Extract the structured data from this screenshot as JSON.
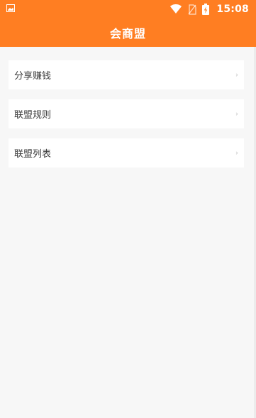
{
  "status_bar": {
    "time": "15:08"
  },
  "header": {
    "title": "会商盟"
  },
  "menu": {
    "items": [
      {
        "label": "分享赚钱",
        "chevron": "›"
      },
      {
        "label": "联盟规则",
        "chevron": "›"
      },
      {
        "label": "联盟列表",
        "chevron": "›"
      }
    ]
  },
  "colors": {
    "accent": "#ff7e22",
    "background": "#f7f7f7",
    "card": "#ffffff"
  }
}
